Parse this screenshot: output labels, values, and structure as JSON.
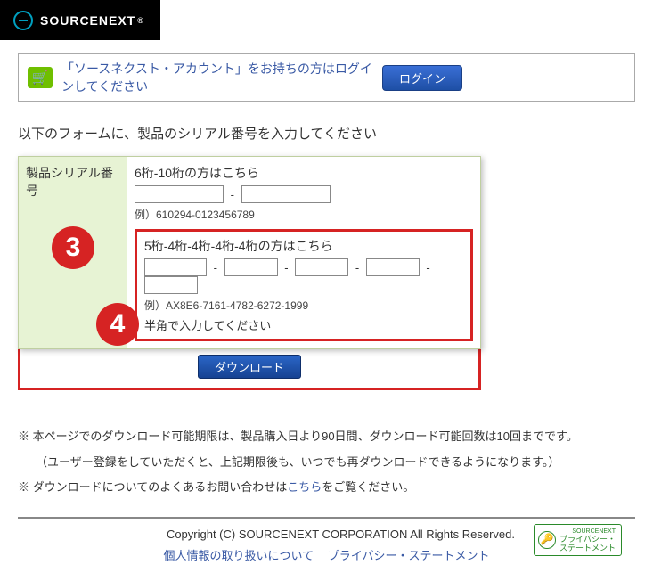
{
  "brand": "SOURCENEXT",
  "brand_suffix": "®",
  "login_bar": {
    "message": "「ソースネクスト・アカウント」をお持ちの方はログインしてください",
    "button": "ログイン"
  },
  "intro": "以下のフォームに、製品のシリアル番号を入力してください",
  "form": {
    "label": "製品シリアル番号",
    "section1": {
      "title": "6桁-10桁の方はこちら",
      "example": "例）610294-0123456789"
    },
    "section2": {
      "title": "5桁-4桁-4桁-4桁-4桁の方はこちら",
      "example": "例）AX8E6-7161-4782-6272-1999",
      "note": "半角で入力してください"
    }
  },
  "download_button": "ダウンロード",
  "markers": {
    "m3": "3",
    "m4": "4"
  },
  "notes": {
    "line1a": "※ 本ページでのダウンロード可能期限は、製品購入日より90日間、ダウンロード可能回数は10回までです。",
    "line1b": "（ユーザー登録をしていただくと、上記期限後も、いつでも再ダウンロードできるようになります。）",
    "line2a": "※ ダウンロードについてのよくあるお問い合わせは",
    "line2link": "こちら",
    "line2b": "をご覧ください。"
  },
  "footer": {
    "copyright": "Copyright (C)  SOURCENEXT CORPORATION All Rights Reserved.",
    "link1": "個人情報の取り扱いについて",
    "link2": "プライバシー・ステートメント",
    "badge_top": "SOURCENEXT",
    "badge_mid": "プライバシー・",
    "badge_bot": "ステートメント"
  }
}
